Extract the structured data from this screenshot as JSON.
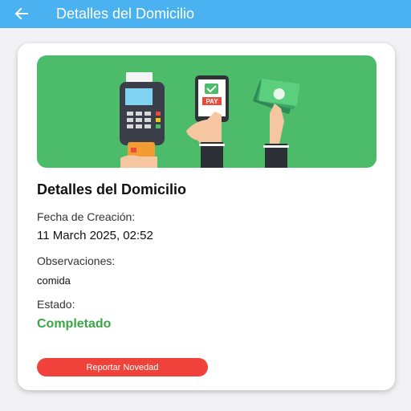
{
  "appbar": {
    "title": "Detalles del Domicilio",
    "back_icon": "arrow-left-icon"
  },
  "banner": {
    "illustration": "payment-methods-illustration",
    "icons": [
      "card-terminal-icon",
      "phone-pay-icon",
      "cash-icon"
    ],
    "pay_label": "PAY"
  },
  "details": {
    "title": "Detalles del Domicilio",
    "fecha_label": "Fecha de Creación:",
    "fecha_value": "11 March 2025, 02:52",
    "observaciones_label": "Observaciones:",
    "observaciones_value": "comida",
    "estado_label": "Estado:",
    "estado_value": "Completado"
  },
  "actions": {
    "report_label": "Reportar Novedad"
  },
  "colors": {
    "appbar": "#4ab2f0",
    "banner": "#4cbb6a",
    "status": "#3aa645",
    "report_button": "#f0423a"
  }
}
